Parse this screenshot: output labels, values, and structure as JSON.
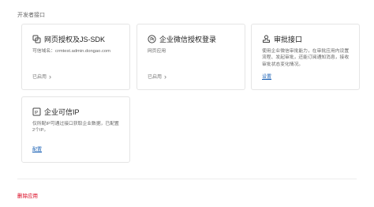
{
  "section_title": "开发者接口",
  "cards": [
    {
      "icon": "link-icon",
      "title": "网页授权及JS-SDK",
      "desc": "可信域名：crmtest.admin.dongao.com",
      "status": "已启用",
      "link": ""
    },
    {
      "icon": "wechat-icon",
      "title": "企业微信授权登录",
      "desc": "网页应用",
      "status": "已启用",
      "link": ""
    },
    {
      "icon": "stamp-icon",
      "title": "审批接口",
      "desc": "使用企业微信审批能力，在审批应用内设置流程、发起审批，还能订阅通知消息，接收审批状态变化情况。",
      "status": "",
      "link": "设置"
    },
    {
      "icon": "ip-icon",
      "title": "企业可信IP",
      "desc": "仅所配IP可通过接口获取企业数据，已配置2个IP。",
      "status": "",
      "link": "配置"
    }
  ],
  "delete_label": "删除应用"
}
